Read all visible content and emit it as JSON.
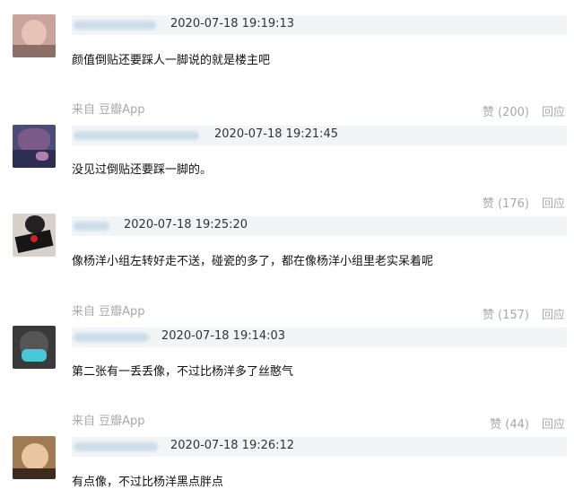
{
  "comments": [
    {
      "timestamp": "2020-07-18 19:19:13",
      "text": "颜值倒贴还要踩人一脚说的就是楼主吧",
      "source": "来自 豆瓣App",
      "like": "赞 (200)",
      "reply": "回应"
    },
    {
      "timestamp": "2020-07-18 19:21:45",
      "text": "没见过倒贴还要踩一脚的。",
      "like": "赞 (176)",
      "reply": "回应"
    },
    {
      "timestamp": "2020-07-18 19:25:20",
      "text": "像杨洋小组左转好走不送，碰瓷的多了，都在像杨洋小组里老实呆着呢",
      "source": "来自 豆瓣App",
      "like": "赞 (157)",
      "reply": "回应"
    },
    {
      "timestamp": "2020-07-18 19:14:03",
      "text": "第二张有一丢丢像，不过比杨洋多了丝憨气",
      "source": "来自 豆瓣App",
      "like": "赞 (44)",
      "reply": "回应"
    },
    {
      "timestamp": "2020-07-18 19:26:12",
      "text": "有点像，不过比杨洋黑点胖点"
    }
  ]
}
